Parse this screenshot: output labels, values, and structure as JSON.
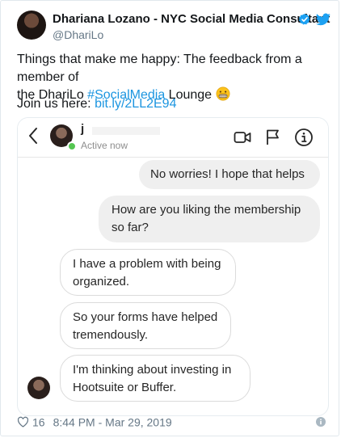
{
  "tweet": {
    "author_name": "Dhariana Lozano - NYC Social Media Consultant",
    "handle": "@DhariLo",
    "text_part1": "Things that make me happy: The feedback from a member of",
    "text_part2": "the DhariLo ",
    "hashtag": "#SocialMedia",
    "text_part3": " Lounge ",
    "join_text": "Join us here: ",
    "link": "bit.ly/2LL2E94",
    "likes": "16",
    "timestamp": "8:44 PM - Mar 29, 2019",
    "icons": {
      "verified": "verified-badge-icon",
      "bird": "twitter-bird-icon",
      "emoji": "grimacing-face-emoji",
      "heart": "heart-icon",
      "info": "info-icon"
    },
    "colors": {
      "accent": "#1b95e0",
      "verified": "#1da1f2",
      "text": "#14171a",
      "muted": "#657786"
    }
  },
  "dm": {
    "contact_name": "j",
    "status": "Active now",
    "icons": [
      "back-chevron-icon",
      "video-call-icon",
      "flag-icon",
      "info-circle-icon"
    ],
    "messages": [
      {
        "from": "me",
        "text": "No worries! I hope that helps"
      },
      {
        "from": "me",
        "text_lines": [
          "How are you liking the membership",
          "so far?"
        ]
      },
      {
        "from": "them",
        "text_lines": [
          "I have a problem with being",
          "organized."
        ]
      },
      {
        "from": "them",
        "text_lines": [
          "So your forms have helped",
          "tremendously."
        ]
      },
      {
        "from": "them",
        "text_lines": [
          "I'm thinking about investing in",
          "Hootsuite or Buffer."
        ]
      }
    ],
    "colors": {
      "online": "#55c652",
      "sent_bg": "#efefef",
      "recv_border": "#dbdbdb"
    }
  }
}
